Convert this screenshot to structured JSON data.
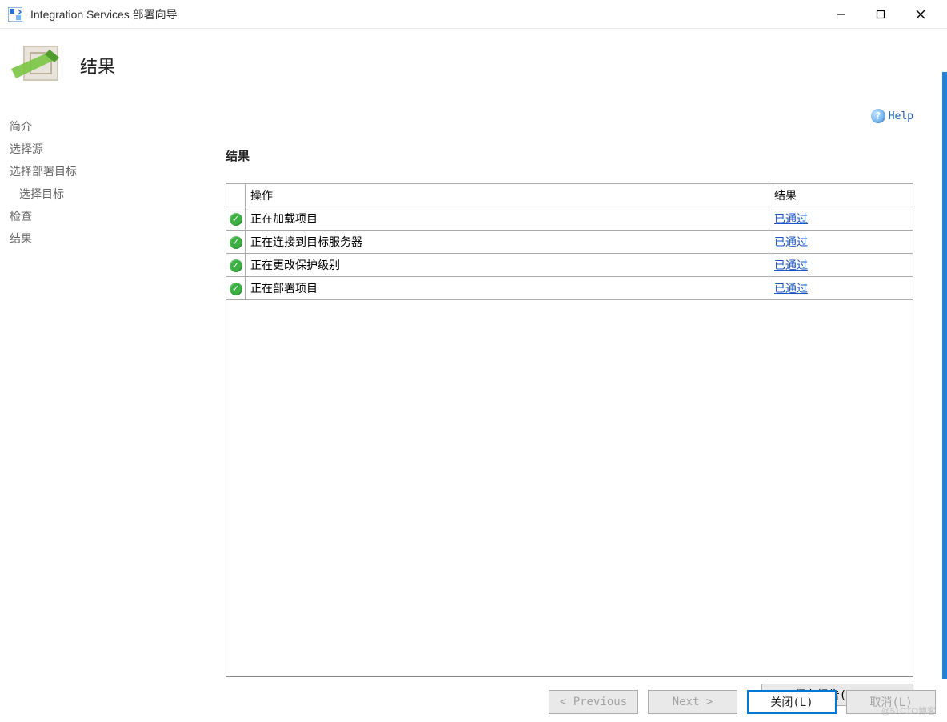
{
  "window": {
    "title": "Integration Services 部署向导"
  },
  "header": {
    "title": "结果"
  },
  "help": {
    "label": "Help"
  },
  "sidebar": {
    "items": [
      {
        "label": "简介"
      },
      {
        "label": "选择源"
      },
      {
        "label": "选择部署目标"
      },
      {
        "label": "选择目标",
        "indent": true
      },
      {
        "label": "检查"
      },
      {
        "label": "结果"
      }
    ]
  },
  "content": {
    "heading": "结果",
    "table": {
      "columns": {
        "action": "操作",
        "result": "结果"
      },
      "rows": [
        {
          "action": "正在加载项目",
          "result": "已通过"
        },
        {
          "action": "正在连接到目标服务器",
          "result": "已通过"
        },
        {
          "action": "正在更改保护级别",
          "result": "已通过"
        },
        {
          "action": "正在部署项目",
          "result": "已通过"
        }
      ]
    },
    "save_report": "保存报告(S)..."
  },
  "footer": {
    "previous": "< Previous",
    "next": "Next >",
    "close": "关闭(L)",
    "cancel": "取消(L)"
  },
  "watermark": "@51CTO博客"
}
